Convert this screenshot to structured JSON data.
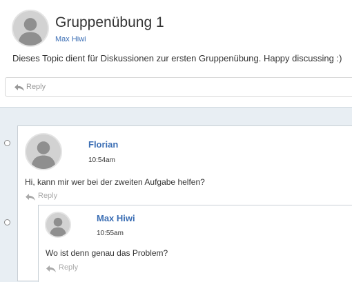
{
  "topic": {
    "title": "Gruppenübung 1",
    "author": "Max Hiwi",
    "description": "Dieses Topic dient für Diskussionen zur ersten Gruppenübung. Happy discussing :)",
    "reply_label": "Reply"
  },
  "posts": [
    {
      "author": "Florian",
      "time": "10:54am",
      "body": "Hi, kann mir wer bei der zweiten Aufgabe helfen?",
      "reply_label": "Reply",
      "replies": [
        {
          "author": "Max Hiwi",
          "time": "10:55am",
          "body": "Wo ist denn genau das Problem?",
          "reply_label": "Reply"
        }
      ]
    }
  ],
  "colors": {
    "link": "#3b6eb4",
    "thread_background": "#e8eef3",
    "border": "#c8cfd5"
  },
  "icons": {
    "avatar": "user-silhouette-icon",
    "reply": "reply-arrow-icon",
    "bullet": "thread-bullet-icon"
  }
}
